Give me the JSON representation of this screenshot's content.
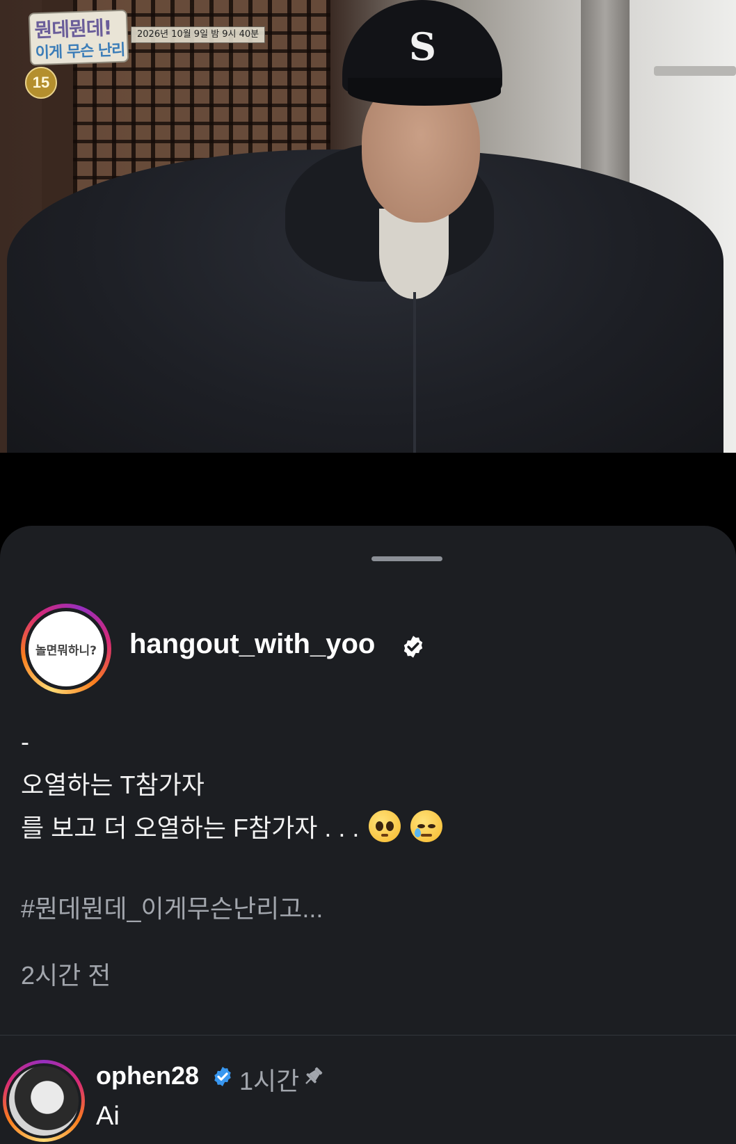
{
  "video": {
    "program_logo_line1": "뭔데뭔데!",
    "program_logo_line2": "이게 무슨 난리고",
    "broadcast_info": "2026년 10월 9일 밤 9시 40분",
    "age_rating": "15",
    "cap_logo": "S"
  },
  "post": {
    "avatar_text": "놀면뭐하니?",
    "username": "hangout_with_yoo",
    "verified_icon": "verified-badge-icon",
    "caption_lines": [
      "-",
      "오열하는 T참가자",
      "를 보고 더 오열하는 F참가자 . . ."
    ],
    "caption_emojis": [
      "pleading-face-icon",
      "face-holding-back-tears-icon"
    ],
    "hashtag": "#뭔데뭔데_이게무슨난리고...",
    "timestamp": "2시간 전"
  },
  "comment": {
    "username": "ophen28",
    "verified_icon": "verified-badge-icon",
    "time": "1시간",
    "pin_icon": "pin-icon",
    "text": "Ai"
  },
  "colors": {
    "sheet_background": "#1c1e22",
    "secondary_text": "#a2a6ad",
    "verified_blue": "#3897f0"
  }
}
